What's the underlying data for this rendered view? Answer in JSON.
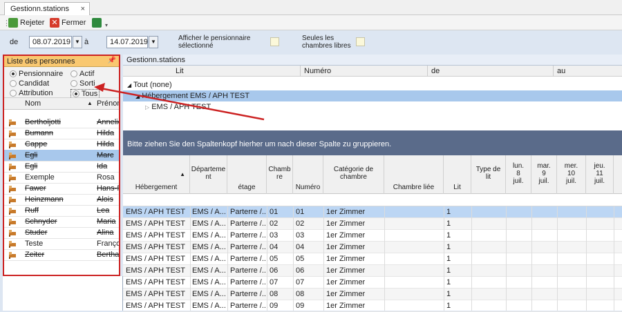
{
  "window": {
    "tab_label": "Gestionn.stations",
    "tab_close": "×"
  },
  "toolbar": {
    "reject_label": "Rejeter",
    "close_label": "Fermer"
  },
  "filter": {
    "from_label": "de",
    "from_value": "08.07.2019",
    "to_label": "à",
    "to_value": "14.07.2019",
    "show_resident_label_1": "Afficher le pensionnaire",
    "show_resident_label_2": "sélectionné",
    "free_rooms_label_1": "Seules les",
    "free_rooms_label_2": "chambres libres"
  },
  "persons": {
    "header": "Liste des personnes",
    "radios": {
      "pensionnaire": "Pensionnaire",
      "actif": "Actif",
      "candidat": "Candidat",
      "sorti": "Sorti",
      "attribution": "Attribution",
      "tous": "Tous"
    },
    "selected_radio": "Tous",
    "col_nom": "Nom",
    "col_prenom": "Prénom",
    "rows": [
      {
        "nom": "Bertholjotti",
        "prenom": "Annelies",
        "struck": true
      },
      {
        "nom": "Bumann",
        "prenom": "Hilda",
        "struck": true
      },
      {
        "nom": "Cappe",
        "prenom": "Hilda",
        "struck": true
      },
      {
        "nom": "Egli",
        "prenom": "Marc",
        "struck": true
      },
      {
        "nom": "Egli",
        "prenom": "Ida",
        "struck": true
      },
      {
        "nom": "Exemple",
        "prenom": "Rosa",
        "struck": false
      },
      {
        "nom": "Fawer",
        "prenom": "Hans-Ru",
        "struck": true
      },
      {
        "nom": "Heinzmann",
        "prenom": "Alois",
        "struck": true
      },
      {
        "nom": "Ruff",
        "prenom": "Lea",
        "struck": true
      },
      {
        "nom": "Schnyder",
        "prenom": "Maria",
        "struck": true
      },
      {
        "nom": "Studer",
        "prenom": "Alina",
        "struck": true
      },
      {
        "nom": "Teste",
        "prenom": "François",
        "struck": false
      },
      {
        "nom": "Zeiter",
        "prenom": "Bertha",
        "struck": true
      }
    ]
  },
  "main": {
    "header": "Gestionn.stations",
    "tree_cols": {
      "lit": "Lit",
      "numero": "Numéro",
      "de": "de",
      "au": "au"
    },
    "tree": {
      "root": "Tout  (none)",
      "level1": "Hébergement  EMS / APH TEST",
      "level2": "EMS / APH TEST"
    },
    "group_hint": "Bitte ziehen Sie den Spaltenkopf hierher um nach dieser Spalte zu gruppieren.",
    "grid_cols": {
      "hebergement": "Hébergement",
      "departement": [
        "Départeme",
        "nt"
      ],
      "etage": "étage",
      "chambre": [
        "Chamb",
        "re"
      ],
      "numero": "Numéro",
      "categorie": [
        "Catégorie de",
        "chambre"
      ],
      "liee": "Chambre liée",
      "lit": "Lit",
      "type": [
        "Type de",
        "lit"
      ],
      "d1": [
        "lun.",
        "8",
        "juil."
      ],
      "d2": [
        "mar.",
        "9",
        "juil."
      ],
      "d3": [
        "mer.",
        "10",
        "juil."
      ],
      "d4": [
        "jeu.",
        "11",
        "juil."
      ]
    },
    "rows": [
      {
        "heb": "EMS / APH TEST",
        "dep": "EMS / A...",
        "etage": "Parterre /...",
        "ch": "01",
        "num": "01",
        "cat": "1er Zimmer",
        "lit": "1"
      },
      {
        "heb": "EMS / APH TEST",
        "dep": "EMS / A...",
        "etage": "Parterre /...",
        "ch": "02",
        "num": "02",
        "cat": "1er Zimmer",
        "lit": "1"
      },
      {
        "heb": "EMS / APH TEST",
        "dep": "EMS / A...",
        "etage": "Parterre /...",
        "ch": "03",
        "num": "03",
        "cat": "1er Zimmer",
        "lit": "1"
      },
      {
        "heb": "EMS / APH TEST",
        "dep": "EMS / A...",
        "etage": "Parterre /...",
        "ch": "04",
        "num": "04",
        "cat": "1er Zimmer",
        "lit": "1"
      },
      {
        "heb": "EMS / APH TEST",
        "dep": "EMS / A...",
        "etage": "Parterre /...",
        "ch": "05",
        "num": "05",
        "cat": "1er Zimmer",
        "lit": "1"
      },
      {
        "heb": "EMS / APH TEST",
        "dep": "EMS / A...",
        "etage": "Parterre /...",
        "ch": "06",
        "num": "06",
        "cat": "1er Zimmer",
        "lit": "1"
      },
      {
        "heb": "EMS / APH TEST",
        "dep": "EMS / A...",
        "etage": "Parterre /...",
        "ch": "07",
        "num": "07",
        "cat": "1er Zimmer",
        "lit": "1"
      },
      {
        "heb": "EMS / APH TEST",
        "dep": "EMS / A...",
        "etage": "Parterre /...",
        "ch": "08",
        "num": "08",
        "cat": "1er Zimmer",
        "lit": "1"
      },
      {
        "heb": "EMS / APH TEST",
        "dep": "EMS / A...",
        "etage": "Parterre /...",
        "ch": "09",
        "num": "09",
        "cat": "1er Zimmer",
        "lit": "1"
      }
    ]
  },
  "colors": {
    "accent": "#cc2222",
    "selected": "#a8c8ec",
    "group_bar": "#5a6b8a",
    "list_header": "#f9c870"
  }
}
